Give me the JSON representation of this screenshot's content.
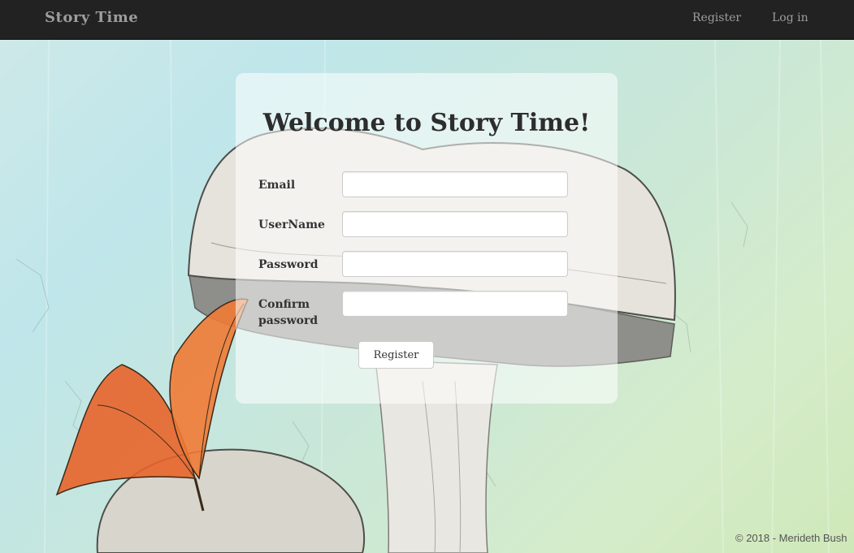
{
  "navbar": {
    "brand": "Story Time",
    "links": [
      {
        "label": "Register"
      },
      {
        "label": "Log in"
      }
    ]
  },
  "form": {
    "title": "Welcome to Story Time!",
    "fields": [
      {
        "label": "Email",
        "value": "",
        "type": "email"
      },
      {
        "label": "UserName",
        "value": "",
        "type": "text"
      },
      {
        "label": "Password",
        "value": "",
        "type": "password"
      },
      {
        "label": "Confirm password",
        "value": "",
        "type": "password"
      }
    ],
    "submit_label": "Register"
  },
  "footer": {
    "text": "© 2018 - Merideth Bush"
  },
  "colors": {
    "navbar_bg": "#222222",
    "nav_text": "#9d9d9d",
    "butterfly": "#e8642a"
  }
}
